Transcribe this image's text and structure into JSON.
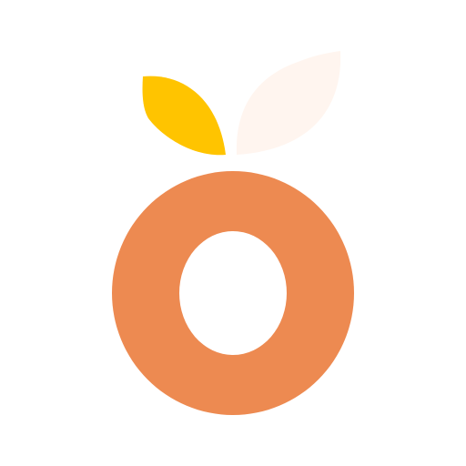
{
  "icon": {
    "name": "orange-fruit-logo",
    "colors": {
      "background": "#ffffff",
      "fruit": "#ED8A51",
      "fruit_hole": "#ffffff",
      "leaf_left": "#FFC400",
      "leaf_right": "#FFF5EF"
    }
  }
}
